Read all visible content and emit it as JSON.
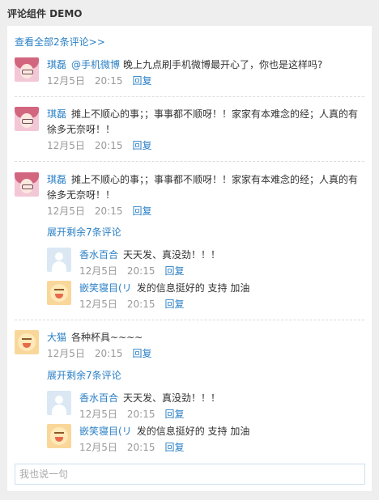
{
  "header": {
    "title": "评论组件 DEMO"
  },
  "view_all": "查看全部2条评论>>",
  "comments": [
    {
      "user": "琪磊",
      "mention": "@手机微博",
      "text": "晚上九点刷手机微博最开心了，你也是这样吗?",
      "date": "12月5日",
      "time": "20:15",
      "reply": "回复"
    },
    {
      "user": "琪磊",
      "text": "摊上不顺心的事；；事事都不顺呀！！家家有本难念的经；人真的有徐多无奈呀！！",
      "date": "12月5日",
      "time": "20:15",
      "reply": "回复"
    },
    {
      "user": "琪磊",
      "text": "摊上不顺心的事；；事事都不顺呀！！家家有本难念的经；人真的有徐多无奈呀！！",
      "date": "12月5日",
      "time": "20:15",
      "reply": "回复",
      "expand": "展开剩余7条评论",
      "replies": [
        {
          "user": "香水百合",
          "text": "天天发、真没劲！！！",
          "date": "12月5日",
          "time": "20:15",
          "reply": "回复"
        },
        {
          "user": "嵌笑寝目(リ",
          "text": "发的信息挺好的 支持 加油",
          "date": "12月5日",
          "time": "20:15",
          "reply": "回复"
        }
      ]
    },
    {
      "user": "大猫",
      "text": "各种杯具~~~~",
      "date": "12月5日",
      "time": "20:15",
      "reply": "回复",
      "expand": "展开剩余7条评论",
      "replies": [
        {
          "user": "香水百合",
          "text": "天天发、真没劲！！！",
          "date": "12月5日",
          "time": "20:15",
          "reply": "回复"
        },
        {
          "user": "嵌笑寝目(リ",
          "text": "发的信息挺好的 支持 加油",
          "date": "12月5日",
          "time": "20:15",
          "reply": "回复"
        }
      ]
    }
  ],
  "input": {
    "placeholder": "我也说一句"
  }
}
